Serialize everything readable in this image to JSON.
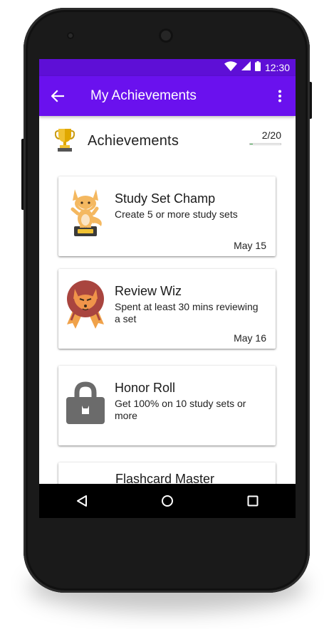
{
  "status_bar": {
    "time": "12:30",
    "icons": [
      "wifi-icon",
      "signal-icon",
      "battery-icon"
    ],
    "color": "#5e0fd6"
  },
  "app_bar": {
    "title": "My Achievements",
    "back_icon": "arrow-back-icon",
    "menu_icon": "more-vert-icon",
    "color": "#6a11ee"
  },
  "achievements": {
    "title": "Achievements",
    "icon": "trophy-icon",
    "progress": "2/20",
    "progress_fraction": 0.1,
    "progress_color": "#58c266"
  },
  "cards": [
    {
      "title": "Study Set Champ",
      "description": "Create 5 or more study sets",
      "date": "May 15",
      "icon": "fox-trophy-badge-icon"
    },
    {
      "title": "Review Wiz",
      "description": "Spent at least 30 mins reviewing a set",
      "date": "May 16",
      "icon": "fox-ribbon-badge-icon"
    },
    {
      "title": "Honor Roll",
      "description": "Get 100% on 10 study sets or more",
      "date": "",
      "icon": "lock-icon"
    },
    {
      "title": "Flashcard Master",
      "description": "",
      "date": "",
      "icon": ""
    }
  ],
  "nav_bar": {
    "icons": [
      "nav-back-icon",
      "nav-home-icon",
      "nav-recents-icon"
    ]
  }
}
